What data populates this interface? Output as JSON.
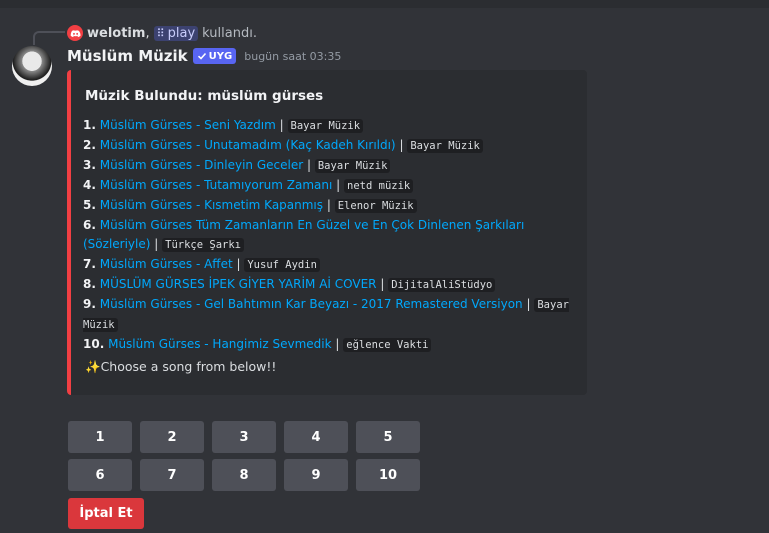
{
  "reply": {
    "user": "welotim",
    "comma": ",",
    "command": "play",
    "used_text": "kullandı."
  },
  "message": {
    "author": "Müslüm Müzik",
    "tag": "UYG",
    "timestamp": "bugün saat 03:35"
  },
  "embed": {
    "title": "Müzik Bulundu: müslüm gürses",
    "items": [
      {
        "num": "1.",
        "link": "Müslüm Gürses - Seni Yazdım",
        "channel": "Bayar Müzik"
      },
      {
        "num": "2.",
        "link": "Müslüm Gürses - Unutamadım (Kaç Kadeh Kırıldı)",
        "channel": "Bayar Müzik"
      },
      {
        "num": "3.",
        "link": "Müslüm Gürses - Dinleyin Geceler",
        "channel": "Bayar Müzik"
      },
      {
        "num": "4.",
        "link": "Müslüm Gürses - Tutamıyorum Zamanı",
        "channel": "netd müzik"
      },
      {
        "num": "5.",
        "link": "Müslüm Gürses - Kısmetim Kapanmış",
        "channel": "Elenor Müzik"
      },
      {
        "num": "6.",
        "link": "Müslüm Gürses Tüm Zamanların En Güzel ve En Çok Dinlenen Şarkıları (Sözleriyle)",
        "channel": "Türkçe Şarkı"
      },
      {
        "num": "7.",
        "link": "Müslüm Gürses - Affet",
        "channel": "Yusuf Aydin"
      },
      {
        "num": "8.",
        "link": "MÜSLÜM GÜRSES İPEK GİYER YARİM Aİ COVER",
        "channel": "DijitalAliStüdyo"
      },
      {
        "num": "9.",
        "link": "Müslüm Gürses - Gel Bahtımın Kar Beyazı - 2017 Remastered Versiyon",
        "channel": "Bayar Müzik"
      },
      {
        "num": "10.",
        "link": "Müslüm Gürses - Hangimiz Sevmedik",
        "channel": "eğlence Vakti"
      }
    ],
    "footer_icon": "sparkles-icon",
    "footer_emoji": "✨",
    "footer_text": "Choose a song from below!!"
  },
  "buttons": {
    "row1": [
      "1",
      "2",
      "3",
      "4",
      "5"
    ],
    "row2": [
      "6",
      "7",
      "8",
      "9",
      "10"
    ],
    "cancel": "İptal Et"
  },
  "colors": {
    "accent": "#f23f43",
    "link": "#00a8fc",
    "tag": "#5865f2",
    "cancel": "#da373c"
  }
}
